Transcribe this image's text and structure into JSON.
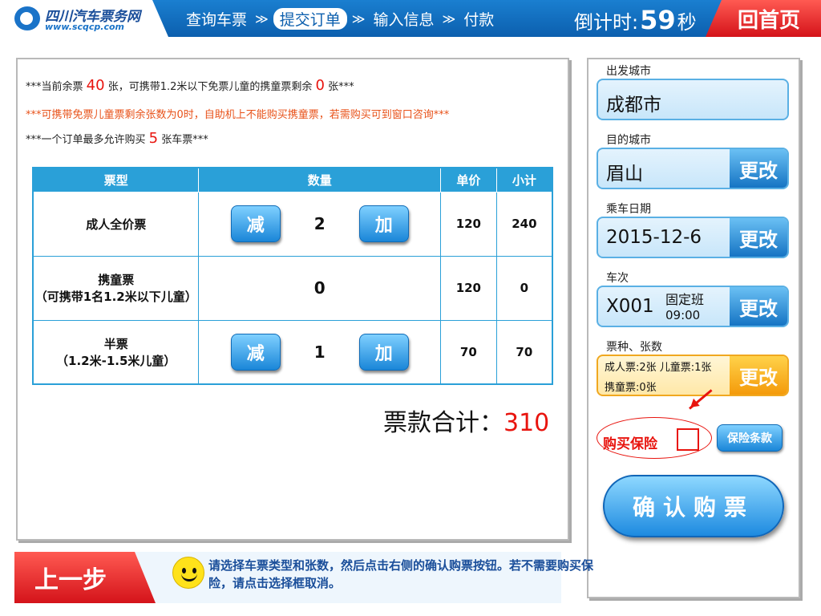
{
  "header": {
    "logo_text": "四川汽车票务网",
    "logo_url": "www.scqcp.com",
    "steps": [
      "查询车票",
      "提交订单",
      "输入信息",
      "付款"
    ],
    "active_step": 1,
    "countdown_label": "倒计时:",
    "countdown_value": "59",
    "countdown_unit": "秒",
    "home_button": "回首页"
  },
  "notices": {
    "line1_a": "***当前余票",
    "line1_remaining": "40",
    "line1_b": "张，可携带1.2米以下免票儿童的携童票剩余",
    "line1_child": "0",
    "line1_c": "张***",
    "line2": "***可携带免票儿童票剩余张数为0时，自助机上不能购买携童票，若需购买可到窗口咨询***",
    "line3_a": "***一个订单最多允许购买",
    "line3_max": "5",
    "line3_b": "张车票***"
  },
  "table": {
    "headers": [
      "票型",
      "数量",
      "单价",
      "小计"
    ],
    "rows": [
      {
        "type": "成人全价票",
        "type2": "",
        "qty": "2",
        "price": "120",
        "subtotal": "240",
        "has_buttons": true
      },
      {
        "type": "携童票",
        "type2": "（可携带1名1.2米以下儿童）",
        "qty": "0",
        "price": "120",
        "subtotal": "0",
        "has_buttons": false
      },
      {
        "type": "半票",
        "type2": "（1.2米-1.5米儿童）",
        "qty": "1",
        "price": "70",
        "subtotal": "70",
        "has_buttons": true
      }
    ],
    "minus_label": "减",
    "plus_label": "加"
  },
  "total": {
    "label": "票款合计：",
    "value": "310"
  },
  "right": {
    "departure_label": "出发城市",
    "departure_value": "成都市",
    "destination_label": "目的城市",
    "destination_value": "眉山",
    "date_label": "乘车日期",
    "date_value": "2015-12-6",
    "trip_label": "车次",
    "trip_no": "X001",
    "trip_type": "固定班",
    "trip_time": "09:00",
    "tickets_label": "票种、张数",
    "tickets_line1": "成人票:2张 儿童票:1张",
    "tickets_line2": "携童票:0张",
    "change_label": "更改",
    "insurance_label": "购买保险",
    "insurance_terms": "保险条款",
    "insurance_checked": false,
    "confirm_label": "确认购票"
  },
  "footer": {
    "back_label": "上一步",
    "tip": "请选择车票类型和张数，然后点击右侧的确认购票按钮。若不需要购买保险，请点击选择框取消。"
  },
  "colors": {
    "accent": "#1a86d8",
    "red": "#e8140e",
    "table_header": "#2aa0d8",
    "subtotal": "#1a1aa8"
  }
}
